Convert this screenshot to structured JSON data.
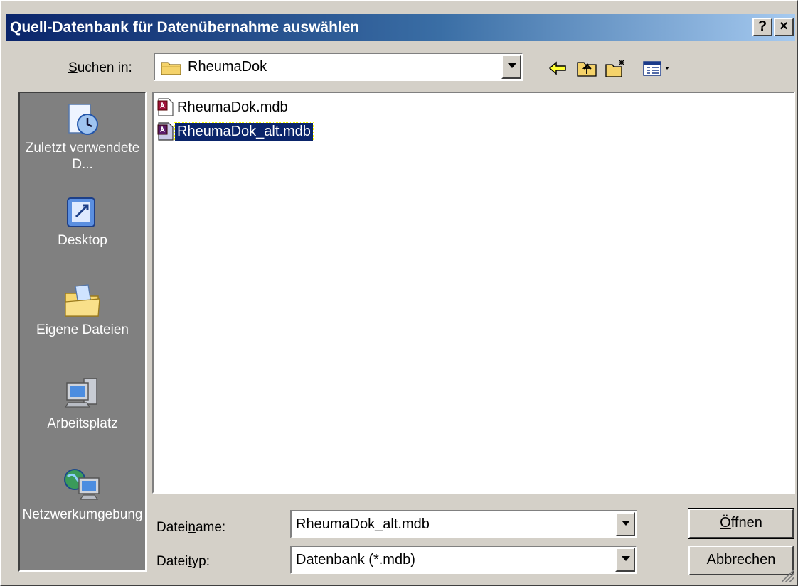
{
  "window": {
    "title": "Quell-Datenbank für Datenübernahme auswählen",
    "help_button": "?",
    "close_button": "×"
  },
  "look_in": {
    "label_prefix": "",
    "label_mnemonic": "S",
    "label_rest": "uchen in:",
    "value": "RheumaDok"
  },
  "places": [
    {
      "label": "Zuletzt verwendete D...",
      "icon": "recent-documents-icon"
    },
    {
      "label": "Desktop",
      "icon": "desktop-icon"
    },
    {
      "label": "Eigene Dateien",
      "icon": "my-documents-icon"
    },
    {
      "label": "Arbeitsplatz",
      "icon": "my-computer-icon"
    },
    {
      "label": "Netzwerkumgebung",
      "icon": "network-icon"
    }
  ],
  "files": [
    {
      "name": "RheumaDok.mdb",
      "selected": false
    },
    {
      "name": "RheumaDok_alt.mdb",
      "selected": true
    }
  ],
  "filename": {
    "label_prefix": "Datei",
    "label_mnemonic": "n",
    "label_rest": "ame:",
    "value": "RheumaDok_alt.mdb"
  },
  "filetype": {
    "label_prefix": "Datei",
    "label_mnemonic": "t",
    "label_rest": "yp:",
    "value": "Datenbank (*.mdb)"
  },
  "buttons": {
    "open_mnemonic": "Ö",
    "open_rest": "ffnen",
    "cancel": "Abbrechen"
  },
  "colors": {
    "titlebar_start": "#0a246a",
    "selection": "#0a246a",
    "places_bg": "#808080"
  }
}
